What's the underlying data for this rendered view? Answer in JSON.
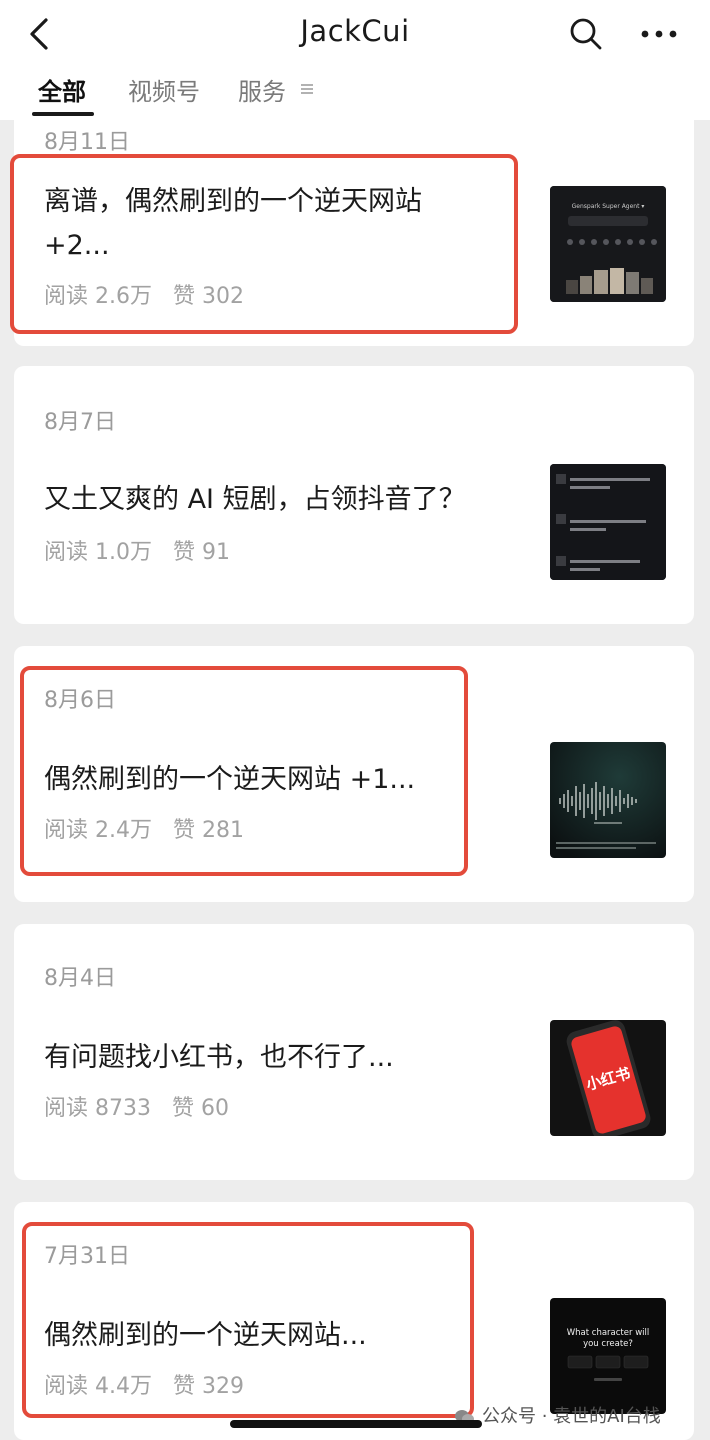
{
  "header": {
    "title": "JackCui",
    "tabs": [
      {
        "label": "全部",
        "active": true
      },
      {
        "label": "视频号",
        "active": false
      },
      {
        "label": "服务",
        "active": false
      }
    ]
  },
  "articles": [
    {
      "date": "8月11日",
      "title": "离谱，偶然刷到的一个逆天网站 +2...",
      "reads": "阅读 2.6万",
      "likes": "赞 302",
      "highlighted": true
    },
    {
      "date": "8月7日",
      "title": "又土又爽的 AI 短剧，占领抖音了？",
      "reads": "阅读 1.0万",
      "likes": "赞 91",
      "highlighted": false
    },
    {
      "date": "8月6日",
      "title": "偶然刷到的一个逆天网站 +1...",
      "reads": "阅读 2.4万",
      "likes": "赞 281",
      "highlighted": true
    },
    {
      "date": "8月4日",
      "title": "有问题找小红书，也不行了...",
      "reads": "阅读 8733",
      "likes": "赞 60",
      "highlighted": false
    },
    {
      "date": "7月31日",
      "title": "偶然刷到的一个逆天网站...",
      "reads": "阅读 4.4万",
      "likes": "赞 329",
      "highlighted": true
    }
  ],
  "thumbnails": {
    "t1_heading": "Genspark Super Agent ▾",
    "t4_logo": "小红书",
    "t5_line1": "What character will",
    "t5_line2": "you create?"
  },
  "watermark": "公众号 · 袁世的AI台栈",
  "colors": {
    "accent_red": "#e34b3b",
    "background": "#ededed",
    "card": "#ffffff"
  }
}
